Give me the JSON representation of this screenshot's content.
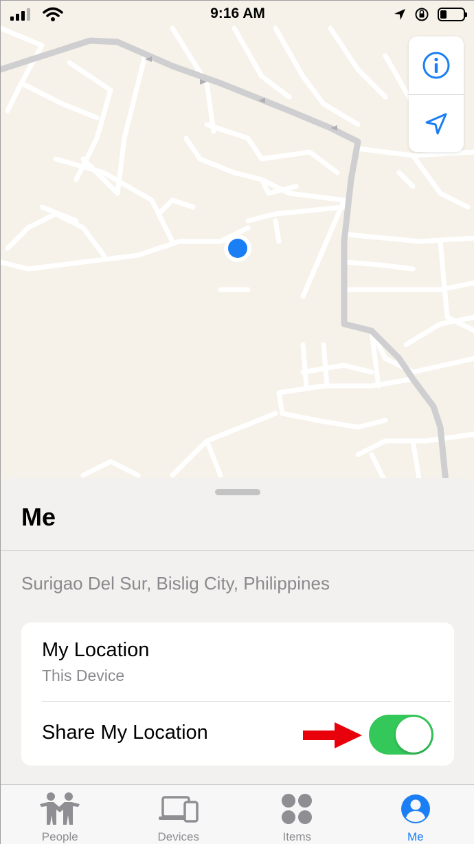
{
  "status_bar": {
    "time": "9:16 AM"
  },
  "map": {
    "background_color": "#f6f2e9",
    "road_color": "#ffffff",
    "highway_color": "#cfcfd1",
    "location_dot_color": "#1a7ef5"
  },
  "map_controls": {
    "info_icon": "info-icon",
    "locate_icon": "location-arrow-icon"
  },
  "sheet": {
    "title": "Me",
    "address": "Surigao Del Sur, Bislig City, Philippines",
    "card": {
      "title": "My Location",
      "subtitle": "This Device",
      "share_label": "Share My Location",
      "share_enabled": true
    }
  },
  "tabs": [
    {
      "label": "People",
      "icon": "people-icon",
      "active": false
    },
    {
      "label": "Devices",
      "icon": "devices-icon",
      "active": false
    },
    {
      "label": "Items",
      "icon": "items-icon",
      "active": false
    },
    {
      "label": "Me",
      "icon": "person-circle-icon",
      "active": true
    }
  ],
  "colors": {
    "accent": "#1a7ef5",
    "toggle_on": "#34c759",
    "annotation_arrow": "#e8000b"
  }
}
